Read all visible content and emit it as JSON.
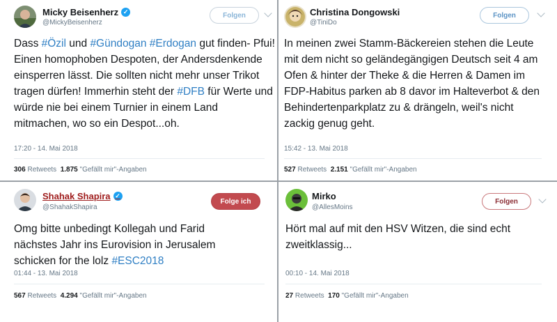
{
  "tweets": [
    {
      "name": "Micky Beisenherz",
      "verified": true,
      "handle": "@MickyBeisenherz",
      "follow_label": "Folgen",
      "text_parts": [
        "Dass ",
        "#Özil",
        " und ",
        "#Gündogan",
        " ",
        "#Erdogan",
        " gut finden- Pfui! Einen homophoben Despoten, der Andersdenkende einsperren lässt. Die sollten nicht mehr unser Trikot tragen dürfen! Immerhin steht der ",
        "#DFB",
        " für Werte und würde nie bei einem Turnier in einem Land mitmachen, wo so ein Despot...oh."
      ],
      "timestamp": "17:20 - 14. Mai 2018",
      "retweets_count": "306",
      "retweets_label": "Retweets",
      "likes_count": "1.875",
      "likes_label": "\"Gefällt mir\"-Angaben"
    },
    {
      "name": "Christina Dongowski",
      "verified": false,
      "handle": "@TiniDo",
      "follow_label": "Folgen",
      "text_parts": [
        "In meinen zwei Stamm-Bäckereien stehen die Leute mit dem nicht so geländegängigen Deutsch seit 4 am Ofen & hinter der Theke & die Herren & Damen im FDP-Habitus parken ab 8 davor im Halteverbot & den Behindertenparkplatz zu & drängeln, weil's nicht zackig genug geht."
      ],
      "timestamp": "15:42 - 13. Mai 2018",
      "retweets_count": "527",
      "retweets_label": "Retweets",
      "likes_count": "2.151",
      "likes_label": "\"Gefällt mir\"-Angaben"
    },
    {
      "name": "Shahak Shapira",
      "verified": true,
      "handle": "@ShahakShapira",
      "follow_label": "Folge ich",
      "text_parts": [
        "Omg bitte unbedingt Kollegah und Farid nächstes Jahr ins Eurovision in Jerusalem schicken for the lolz ",
        "#ESC2018"
      ],
      "timestamp": "01:44 - 13. Mai 2018",
      "retweets_count": "567",
      "retweets_label": "Retweets",
      "likes_count": "4.294",
      "likes_label": "\"Gefällt mir\"-Angaben"
    },
    {
      "name": "Mirko",
      "verified": false,
      "handle": "@AllesMoins",
      "follow_label": "Folgen",
      "text_parts": [
        "Hört mal auf mit den HSV Witzen, die sind echt zweitklassig..."
      ],
      "timestamp": "00:10 - 14. Mai 2018",
      "retweets_count": "27",
      "retweets_label": "Retweets",
      "likes_count": "170",
      "likes_label": "\"Gefällt mir\"-Angaben"
    }
  ],
  "colors": {
    "hashtag": "#2f7fc4",
    "verified": "#1da1f2",
    "following_button": "#c24a4f",
    "meta_text": "#657786"
  },
  "icons": {
    "verified": "verified-badge-icon",
    "more": "chevron-down-icon"
  }
}
